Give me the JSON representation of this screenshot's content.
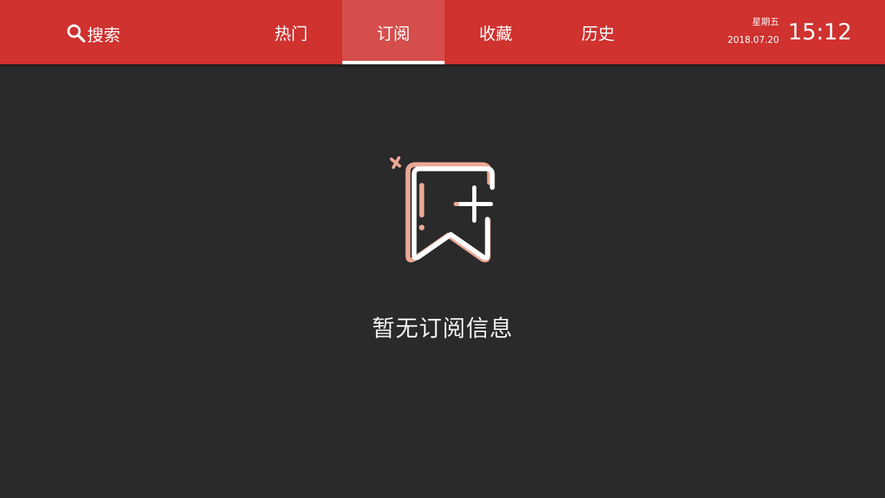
{
  "header": {
    "search": {
      "label": "搜索",
      "icon": "search-icon"
    },
    "tabs": [
      {
        "label": "热门",
        "active": false
      },
      {
        "label": "订阅",
        "active": true
      },
      {
        "label": "收藏",
        "active": false
      },
      {
        "label": "历史",
        "active": false
      }
    ],
    "clock": {
      "weekday": "星期五",
      "date": "2018.07.20",
      "time": "15:12"
    }
  },
  "main": {
    "empty_state": {
      "icon": "bookmark-add-icon",
      "message": "暂无订阅信息"
    }
  },
  "colors": {
    "header_bg": "#cf322f",
    "active_tab_bg": "#d54e4c",
    "page_bg": "#2a2a2a",
    "icon_accent": "#eba896",
    "text": "#ffffff"
  }
}
